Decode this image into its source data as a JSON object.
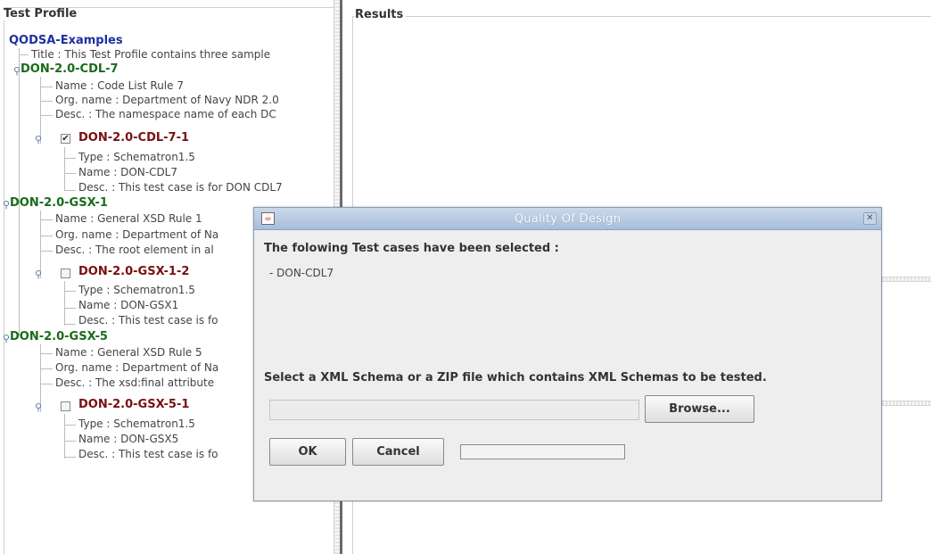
{
  "left_panel": {
    "title": "Test Profile",
    "root": "QODSA-Examples",
    "root_title": "Title : This Test Profile contains three sample",
    "rules": [
      {
        "label": "DON-2.0-CDL-7",
        "name": "Name : Code List Rule 7",
        "org": "Org. name : Department of Navy NDR 2.0",
        "desc": "Desc. : The namespace name of each DC",
        "case": {
          "label": "DON-2.0-CDL-7-1",
          "checked": true,
          "type": "Type : Schematron1.5",
          "name": "Name : DON-CDL7",
          "desc": "Desc. : This test case is for DON CDL7"
        }
      },
      {
        "label": "DON-2.0-GSX-1",
        "name": "Name : General XSD Rule 1",
        "org": "Org. name : Department of Na",
        "desc": "Desc. : The root element in al",
        "case": {
          "label": "DON-2.0-GSX-1-2",
          "checked": false,
          "type": "Type : Schematron1.5",
          "name": "Name : DON-GSX1",
          "desc": "Desc. : This test case is fo"
        }
      },
      {
        "label": "DON-2.0-GSX-5",
        "name": "Name : General XSD Rule 5",
        "org": "Org. name : Department of Na",
        "desc": "Desc. : The xsd:final attribute",
        "case": {
          "label": "DON-2.0-GSX-5-1",
          "checked": false,
          "type": "Type : Schematron1.5",
          "name": "Name : DON-GSX5",
          "desc": "Desc. : This test case is fo"
        }
      }
    ]
  },
  "right_panel": {
    "title": "Results"
  },
  "dialog": {
    "title": "Quality Of Design",
    "heading": "The folowing Test cases have been selected :",
    "selected_item": "- DON-CDL7",
    "instruction": "Select a XML Schema or a ZIP file which contains XML Schemas to be tested.",
    "file_path": "",
    "browse_label": "Browse...",
    "ok_label": "OK",
    "cancel_label": "Cancel",
    "progress": 0
  },
  "icons": {
    "app": "java-app-icon",
    "close": "close-icon",
    "expand": "tree-expand-handle-icon",
    "check": "checkmark-icon"
  },
  "colors": {
    "root": "#1f2fa0",
    "rule": "#1a6b1a",
    "testcase": "#7a1010",
    "titlebar": "#a9bedb"
  }
}
